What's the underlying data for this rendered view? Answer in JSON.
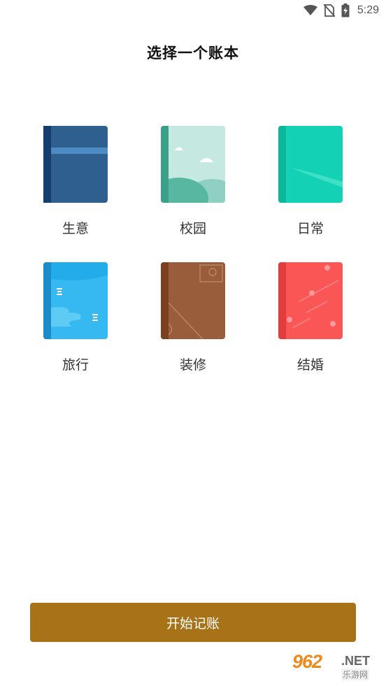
{
  "status_bar": {
    "time": "5:29",
    "icons": [
      "wifi-icon",
      "no-sim-icon",
      "battery-charging-icon"
    ]
  },
  "header": {
    "title": "选择一个账本"
  },
  "books": [
    {
      "label": "生意",
      "icon": "business-book-icon",
      "color": "#2e5f8f"
    },
    {
      "label": "校园",
      "icon": "campus-book-icon",
      "color": "#c5e9e0"
    },
    {
      "label": "日常",
      "icon": "daily-book-icon",
      "color": "#13d1b5"
    },
    {
      "label": "旅行",
      "icon": "travel-book-icon",
      "color": "#36b9f0"
    },
    {
      "label": "装修",
      "icon": "decoration-book-icon",
      "color": "#9a5d3c"
    },
    {
      "label": "结婚",
      "icon": "wedding-book-icon",
      "color": "#fb5656"
    }
  ],
  "actions": {
    "start_label": "开始记账",
    "start_color": "#a87219"
  },
  "watermark": {
    "brand": "962",
    "domain": ".NET",
    "site_name": "乐游网"
  }
}
